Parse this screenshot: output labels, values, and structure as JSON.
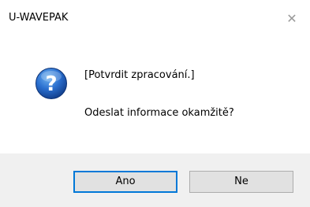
{
  "window": {
    "title": "U-WAVEPAK",
    "close_glyph": "✕"
  },
  "content": {
    "icon": "question-icon",
    "icon_glyph": "?",
    "heading": "[Potvrdit zpracování.]",
    "message": "Odeslat informace okamžitě?"
  },
  "buttons": {
    "yes_label": "Ano",
    "no_label": "Ne",
    "default": "yes"
  },
  "colors": {
    "accent": "#0078d7",
    "footer_bg": "#f0f0f0",
    "icon_blue": "#1f5fb5"
  }
}
